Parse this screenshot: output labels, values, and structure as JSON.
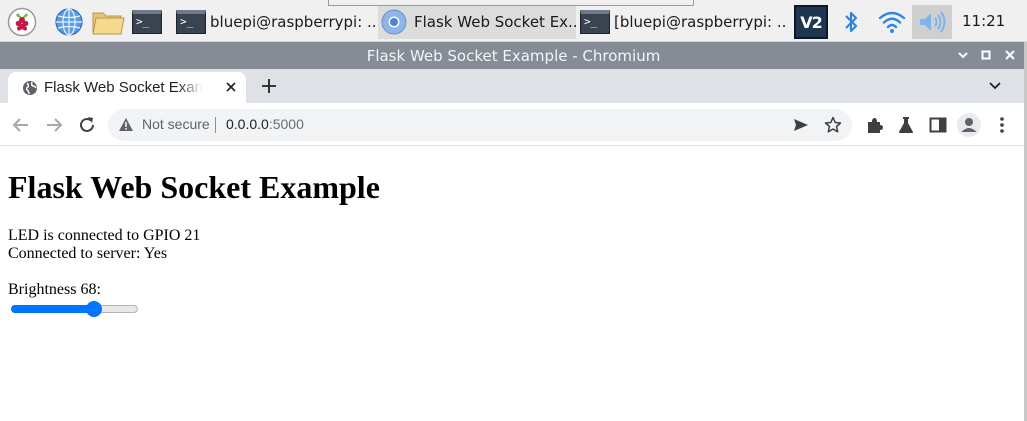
{
  "taskbar": {
    "windows": [
      {
        "label": "bluepi@raspberrypi: ...",
        "active": false
      },
      {
        "label": "Flask Web Socket Ex...",
        "active": true
      },
      {
        "label": "[bluepi@raspberrypi: ...",
        "active": false
      }
    ],
    "clock": "11:21",
    "terminal_glyph": ">_",
    "vnc_label": "V2"
  },
  "window": {
    "title": "Flask Web Socket Example - Chromium"
  },
  "browser": {
    "tab_title": "Flask Web Socket Example",
    "security_label": "Not secure",
    "url_host": "0.0.0.0",
    "url_port": ":5000"
  },
  "page": {
    "heading": "Flask Web Socket Example",
    "led_info": "LED is connected to GPIO 21",
    "connection_status": "Connected to server: Yes",
    "brightness_label": "Brightness 68:",
    "brightness_fraction": 0.68
  },
  "colors": {
    "accent": "#0075ff",
    "titlebar": "#858c96",
    "tabstrip": "#dee1e6"
  }
}
